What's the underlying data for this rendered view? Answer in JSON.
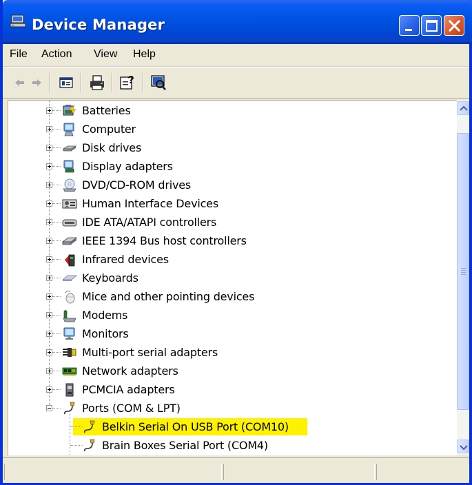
{
  "window": {
    "title": "Device Manager",
    "icon": "device-manager-icon",
    "controls": [
      "minimize",
      "maximize",
      "close"
    ],
    "colors": {
      "titlebar": "#0054e3",
      "frame": "#ece9d8",
      "highlight": "#fff200"
    }
  },
  "menu": {
    "items": [
      {
        "label": "File"
      },
      {
        "label": "Action"
      },
      {
        "label": "View"
      },
      {
        "label": "Help"
      }
    ]
  },
  "toolbar": {
    "buttons": [
      {
        "name": "back-icon"
      },
      {
        "name": "forward-icon"
      },
      {
        "name": "properties-icon"
      },
      {
        "name": "print-icon"
      },
      {
        "name": "help-icon"
      },
      {
        "name": "scan-hardware-icon"
      }
    ]
  },
  "tree": {
    "items": [
      {
        "label": "Batteries",
        "icon": "battery-icon",
        "expanded": false
      },
      {
        "label": "Computer",
        "icon": "computer-icon",
        "expanded": false
      },
      {
        "label": "Disk drives",
        "icon": "disk-drive-icon",
        "expanded": false
      },
      {
        "label": "Display adapters",
        "icon": "display-adapter-icon",
        "expanded": false
      },
      {
        "label": "DVD/CD-ROM drives",
        "icon": "cd-drive-icon",
        "expanded": false
      },
      {
        "label": "Human Interface Devices",
        "icon": "hid-icon",
        "expanded": false
      },
      {
        "label": "IDE ATA/ATAPI controllers",
        "icon": "ide-controller-icon",
        "expanded": false
      },
      {
        "label": "IEEE 1394 Bus host controllers",
        "icon": "firewire-icon",
        "expanded": false
      },
      {
        "label": "Infrared devices",
        "icon": "infrared-icon",
        "expanded": false
      },
      {
        "label": "Keyboards",
        "icon": "keyboard-icon",
        "expanded": false
      },
      {
        "label": "Mice and other pointing devices",
        "icon": "mouse-icon",
        "expanded": false
      },
      {
        "label": "Modems",
        "icon": "modem-icon",
        "expanded": false
      },
      {
        "label": "Monitors",
        "icon": "monitor-icon",
        "expanded": false
      },
      {
        "label": "Multi-port serial adapters",
        "icon": "serial-adapter-icon",
        "expanded": false
      },
      {
        "label": "Network adapters",
        "icon": "network-adapter-icon",
        "expanded": false
      },
      {
        "label": "PCMCIA adapters",
        "icon": "pcmcia-icon",
        "expanded": false
      },
      {
        "label": "Ports (COM & LPT)",
        "icon": "port-icon",
        "expanded": true
      }
    ],
    "children": [
      {
        "label": "Belkin Serial On USB Port (COM10)",
        "icon": "port-icon",
        "highlighted": true
      },
      {
        "label": "Brain Boxes Serial Port (COM4)",
        "icon": "port-icon",
        "highlighted": false
      }
    ]
  },
  "scrollbar": {
    "up": "scroll-up-icon",
    "down": "scroll-down-icon"
  },
  "statusbar": {
    "panes": [
      "",
      "",
      ""
    ]
  }
}
